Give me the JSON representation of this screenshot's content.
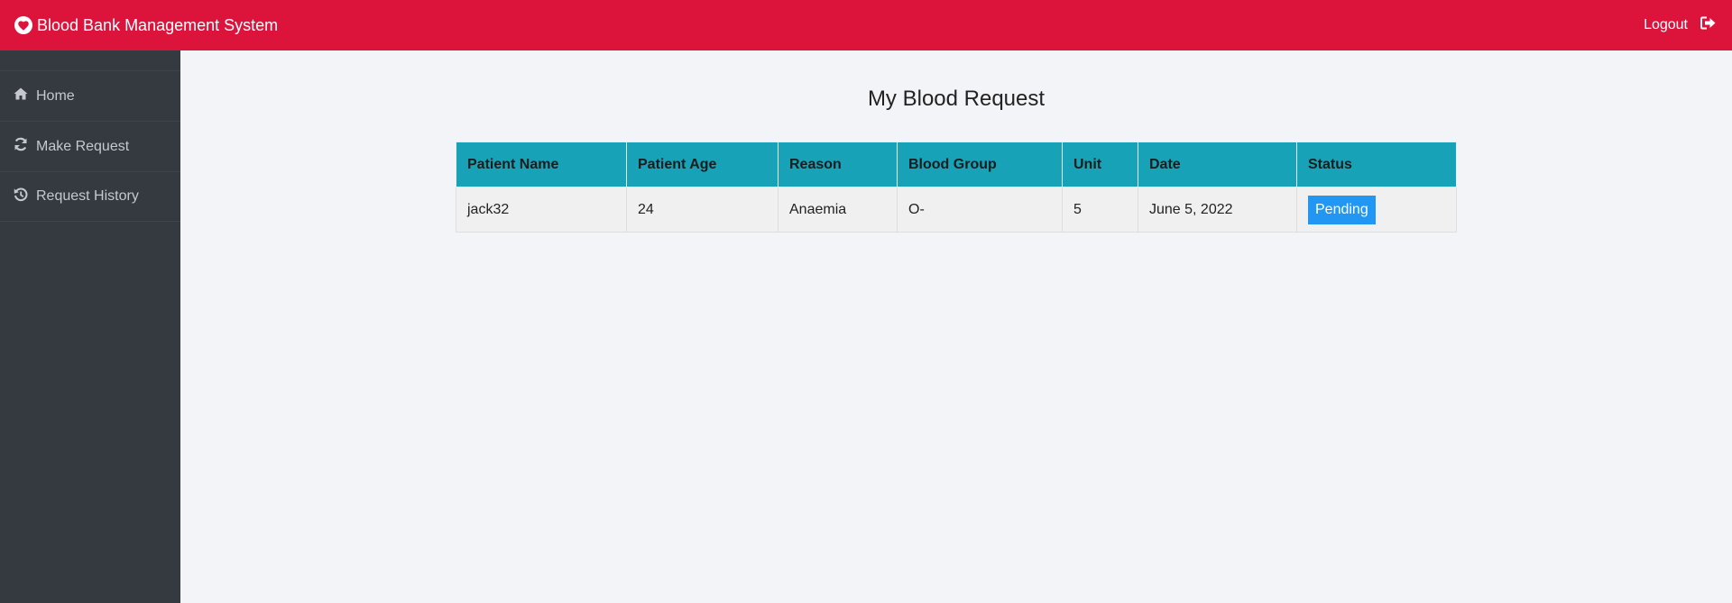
{
  "app": {
    "title": "Blood Bank Management System",
    "logout_label": "Logout"
  },
  "colors": {
    "header": "#dc143c",
    "sidebar": "#343a40",
    "table_header": "#17a2b8",
    "badge_pending": "#2196f3"
  },
  "sidebar": {
    "items": [
      {
        "label": "Home",
        "icon": "home-icon"
      },
      {
        "label": "Make Request",
        "icon": "refresh-icon"
      },
      {
        "label": "Request History",
        "icon": "history-icon"
      }
    ]
  },
  "main": {
    "title": "My Blood Request",
    "table": {
      "headers": [
        "Patient Name",
        "Patient Age",
        "Reason",
        "Blood Group",
        "Unit",
        "Date",
        "Status"
      ],
      "rows": [
        {
          "patient_name": "jack32",
          "patient_age": "24",
          "reason": "Anaemia",
          "blood_group": "O-",
          "unit": "5",
          "date": "June 5, 2022",
          "status": "Pending"
        }
      ]
    }
  }
}
